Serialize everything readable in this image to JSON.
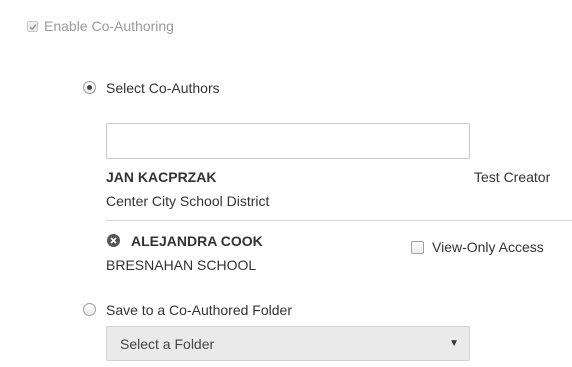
{
  "enable_coauthoring": {
    "label": "Enable Co-Authoring",
    "checked": true,
    "disabled": true
  },
  "options": {
    "select_coauthors": {
      "label": "Select Co-Authors",
      "selected": true
    },
    "coauthored_folder": {
      "label": "Save to a Co-Authored Folder",
      "selected": false
    }
  },
  "search": {
    "value": "",
    "placeholder": ""
  },
  "coauthors": [
    {
      "name": "JAN KACPRZAK",
      "organization": "Center City School District",
      "role": "Test Creator"
    },
    {
      "name": "ALEJANDRA COOK",
      "organization": "BRESNAHAN SCHOOL",
      "view_only_label": "View-Only Access",
      "view_only_checked": false
    }
  ],
  "folder_select": {
    "value": "Select a Folder"
  }
}
